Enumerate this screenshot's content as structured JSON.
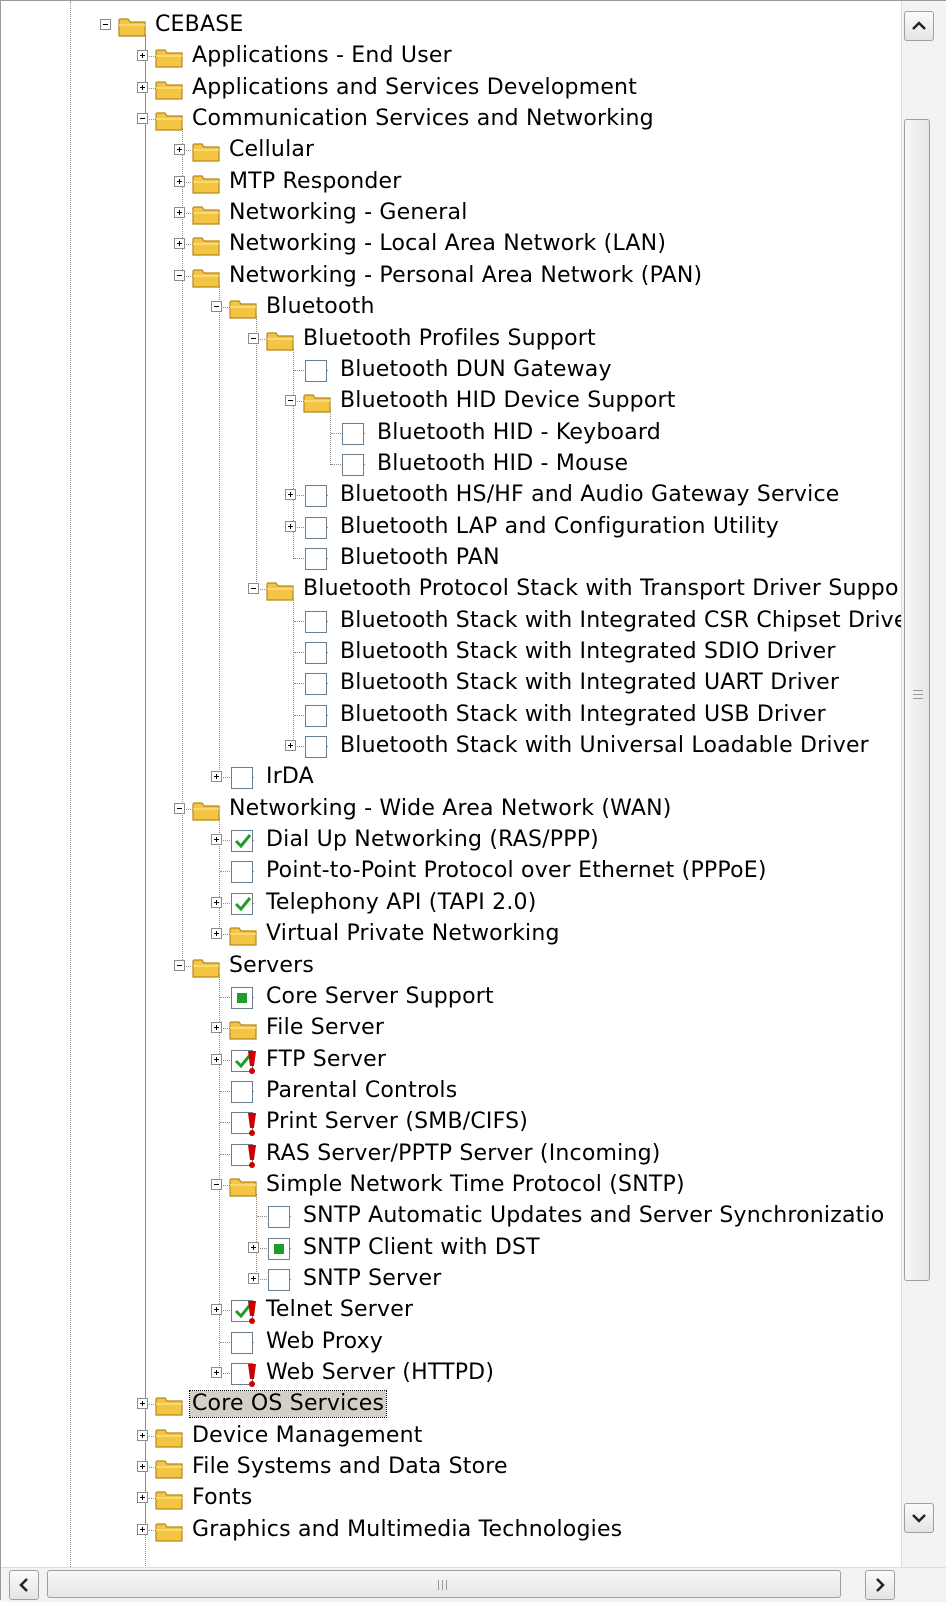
{
  "tree": {
    "items": [
      {
        "depth": 0,
        "type": "folder",
        "exp": "minus",
        "label": "CEBASE"
      },
      {
        "depth": 1,
        "type": "folder",
        "exp": "plus",
        "label": "Applications - End User"
      },
      {
        "depth": 1,
        "type": "folder",
        "exp": "plus",
        "label": "Applications and Services Development"
      },
      {
        "depth": 1,
        "type": "folder",
        "exp": "minus",
        "label": "Communication Services and Networking"
      },
      {
        "depth": 2,
        "type": "folder",
        "exp": "plus",
        "label": "Cellular"
      },
      {
        "depth": 2,
        "type": "folder",
        "exp": "plus",
        "label": "MTP Responder"
      },
      {
        "depth": 2,
        "type": "folder",
        "exp": "plus",
        "label": "Networking - General"
      },
      {
        "depth": 2,
        "type": "folder",
        "exp": "plus",
        "label": "Networking - Local Area Network (LAN)"
      },
      {
        "depth": 2,
        "type": "folder",
        "exp": "minus",
        "label": "Networking - Personal Area Network (PAN)"
      },
      {
        "depth": 3,
        "type": "folder",
        "exp": "minus",
        "label": "Bluetooth"
      },
      {
        "depth": 4,
        "type": "folder",
        "exp": "minus",
        "label": "Bluetooth Profiles Support"
      },
      {
        "depth": 5,
        "type": "check",
        "exp": "none",
        "state": "unchecked",
        "label": "Bluetooth DUN Gateway"
      },
      {
        "depth": 5,
        "type": "folder",
        "exp": "minus",
        "label": "Bluetooth HID Device Support"
      },
      {
        "depth": 6,
        "type": "check",
        "exp": "none",
        "state": "unchecked",
        "label": "Bluetooth HID - Keyboard"
      },
      {
        "depth": 6,
        "type": "check",
        "exp": "none",
        "state": "unchecked",
        "label": "Bluetooth HID - Mouse"
      },
      {
        "depth": 5,
        "type": "check",
        "exp": "plus",
        "state": "unchecked",
        "label": "Bluetooth HS/HF and Audio Gateway Service"
      },
      {
        "depth": 5,
        "type": "check",
        "exp": "plus",
        "state": "unchecked",
        "label": "Bluetooth LAP and Configuration Utility"
      },
      {
        "depth": 5,
        "type": "check",
        "exp": "none",
        "state": "unchecked",
        "label": "Bluetooth PAN"
      },
      {
        "depth": 4,
        "type": "folder",
        "exp": "minus",
        "label": "Bluetooth Protocol Stack with Transport Driver Suppo"
      },
      {
        "depth": 5,
        "type": "check",
        "exp": "none",
        "state": "unchecked",
        "label": "Bluetooth Stack with Integrated CSR Chipset Drive"
      },
      {
        "depth": 5,
        "type": "check",
        "exp": "none",
        "state": "unchecked",
        "label": "Bluetooth Stack with Integrated SDIO Driver"
      },
      {
        "depth": 5,
        "type": "check",
        "exp": "none",
        "state": "unchecked",
        "label": "Bluetooth Stack with Integrated UART Driver"
      },
      {
        "depth": 5,
        "type": "check",
        "exp": "none",
        "state": "unchecked",
        "label": "Bluetooth Stack with Integrated USB Driver"
      },
      {
        "depth": 5,
        "type": "check",
        "exp": "plus",
        "state": "unchecked",
        "label": "Bluetooth Stack with Universal Loadable Driver"
      },
      {
        "depth": 3,
        "type": "check",
        "exp": "plus",
        "state": "unchecked",
        "label": "IrDA"
      },
      {
        "depth": 2,
        "type": "folder",
        "exp": "minus",
        "label": "Networking - Wide Area Network (WAN)"
      },
      {
        "depth": 3,
        "type": "check",
        "exp": "plus",
        "state": "checked",
        "label": "Dial Up Networking (RAS/PPP)"
      },
      {
        "depth": 3,
        "type": "check",
        "exp": "none",
        "state": "unchecked",
        "label": "Point-to-Point Protocol over Ethernet (PPPoE)"
      },
      {
        "depth": 3,
        "type": "check",
        "exp": "plus",
        "state": "checked",
        "label": "Telephony API (TAPI 2.0)"
      },
      {
        "depth": 3,
        "type": "folder",
        "exp": "plus",
        "label": "Virtual Private Networking"
      },
      {
        "depth": 2,
        "type": "folder",
        "exp": "minus",
        "label": "Servers"
      },
      {
        "depth": 3,
        "type": "check",
        "exp": "none",
        "state": "partial",
        "label": "Core Server Support"
      },
      {
        "depth": 3,
        "type": "folder",
        "exp": "plus",
        "label": "File Server"
      },
      {
        "depth": 3,
        "type": "check",
        "exp": "plus",
        "state": "checked",
        "warn": true,
        "label": "FTP Server"
      },
      {
        "depth": 3,
        "type": "check",
        "exp": "none",
        "state": "unchecked",
        "label": "Parental Controls"
      },
      {
        "depth": 3,
        "type": "check",
        "exp": "none",
        "state": "unchecked",
        "warn": true,
        "label": "Print Server (SMB/CIFS)"
      },
      {
        "depth": 3,
        "type": "check",
        "exp": "none",
        "state": "unchecked",
        "warn": true,
        "label": "RAS Server/PPTP Server (Incoming)"
      },
      {
        "depth": 3,
        "type": "folder",
        "exp": "minus",
        "label": "Simple Network Time Protocol (SNTP)"
      },
      {
        "depth": 4,
        "type": "check",
        "exp": "none",
        "state": "unchecked",
        "label": "SNTP Automatic Updates and Server Synchronizatio"
      },
      {
        "depth": 4,
        "type": "check",
        "exp": "plus",
        "state": "partial",
        "label": "SNTP Client with DST"
      },
      {
        "depth": 4,
        "type": "check",
        "exp": "plus",
        "state": "unchecked",
        "label": "SNTP Server"
      },
      {
        "depth": 3,
        "type": "check",
        "exp": "plus",
        "state": "checked",
        "warn": true,
        "label": "Telnet Server"
      },
      {
        "depth": 3,
        "type": "check",
        "exp": "none",
        "state": "unchecked",
        "label": "Web Proxy"
      },
      {
        "depth": 3,
        "type": "check",
        "exp": "plus",
        "state": "unchecked",
        "warn": true,
        "label": "Web Server (HTTPD)"
      },
      {
        "depth": 1,
        "type": "folder",
        "exp": "plus",
        "label": "Core OS Services",
        "selected": true
      },
      {
        "depth": 1,
        "type": "folder",
        "exp": "plus",
        "label": "Device Management"
      },
      {
        "depth": 1,
        "type": "folder",
        "exp": "plus",
        "label": "File Systems and Data Store"
      },
      {
        "depth": 1,
        "type": "folder",
        "exp": "plus",
        "label": "Fonts"
      },
      {
        "depth": 1,
        "type": "folder",
        "exp": "plus",
        "label": "Graphics and Multimedia Technologies"
      }
    ]
  },
  "scrollbars": {
    "vertical": {
      "up_icon": "arrow-up-icon",
      "down_icon": "arrow-down-icon"
    },
    "horizontal": {
      "left_icon": "arrow-left-icon",
      "right_icon": "arrow-right-icon"
    }
  },
  "colors": {
    "check_green": "#1f9d2a",
    "warning_red": "#cc0000",
    "folder_yellow": "#f4c542",
    "selection": "#d4d0c8"
  }
}
